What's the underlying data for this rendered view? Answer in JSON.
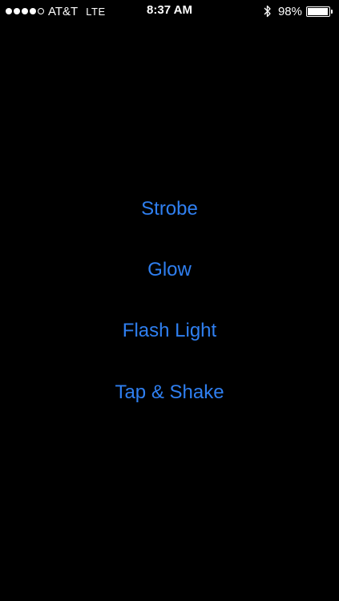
{
  "status_bar": {
    "signal_bars_filled": 4,
    "signal_bars_total": 5,
    "carrier": "AT&T",
    "network": "LTE",
    "time": "8:37 AM",
    "bluetooth_icon": "bluetooth-icon",
    "battery_percent": "98%",
    "battery_level": 0.98
  },
  "menu": {
    "accent_color": "#2f7ff0",
    "items": [
      {
        "label": "Strobe"
      },
      {
        "label": "Glow"
      },
      {
        "label": "Flash Light"
      },
      {
        "label": "Tap & Shake"
      }
    ]
  },
  "colors": {
    "background": "#000000",
    "status_text": "#ffffff"
  }
}
